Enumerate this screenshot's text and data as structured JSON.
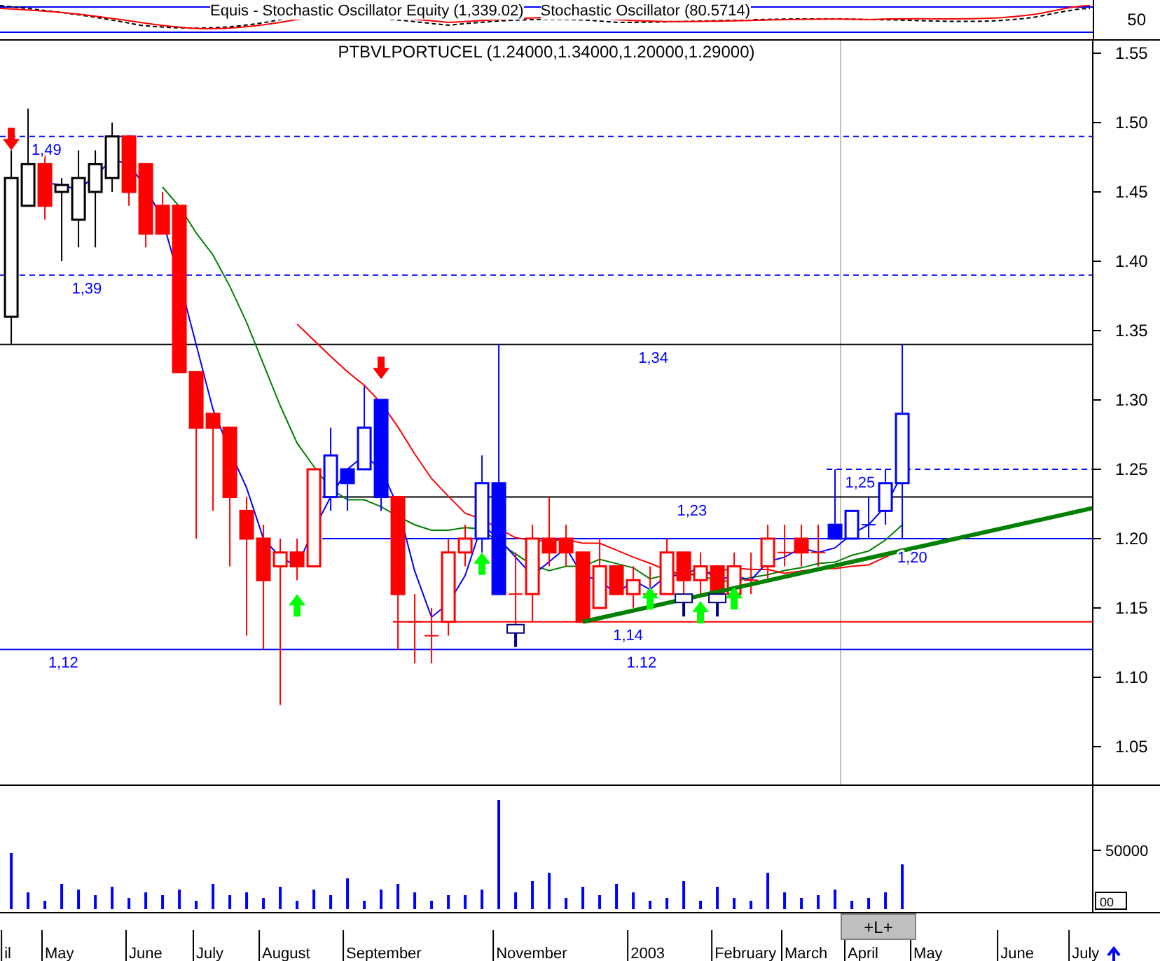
{
  "stochastic_pane": {
    "titles": [
      "Equis - Stochastic Oscillator Equity (1,339.02)",
      "Stochastic Oscillator (80.5714)"
    ],
    "axis_label": "50"
  },
  "price_pane": {
    "title": "PTBVLPORTUCEL (1.24000,1.34000,1.20000,1.29000)",
    "axis_labels": [
      "1.55",
      "1.50",
      "1.45",
      "1.40",
      "1.35",
      "1.30",
      "1.25",
      "1.20",
      "1.15",
      "1.10",
      "1.05"
    ],
    "level_labels": [
      "1,49",
      "1,39",
      "1,34",
      "1,25",
      "1,23",
      "1,20",
      "1,14",
      "1,12",
      "1.12"
    ]
  },
  "volume_pane": {
    "axis_label": "50000",
    "corner_label": "00"
  },
  "date_axis": {
    "labels": [
      "il",
      "May",
      "June",
      "July",
      "August",
      "September",
      "November",
      "2003",
      "February",
      "March",
      "April",
      "May",
      "June",
      "July"
    ],
    "scroll_button": {
      "label": "+L+"
    }
  }
}
